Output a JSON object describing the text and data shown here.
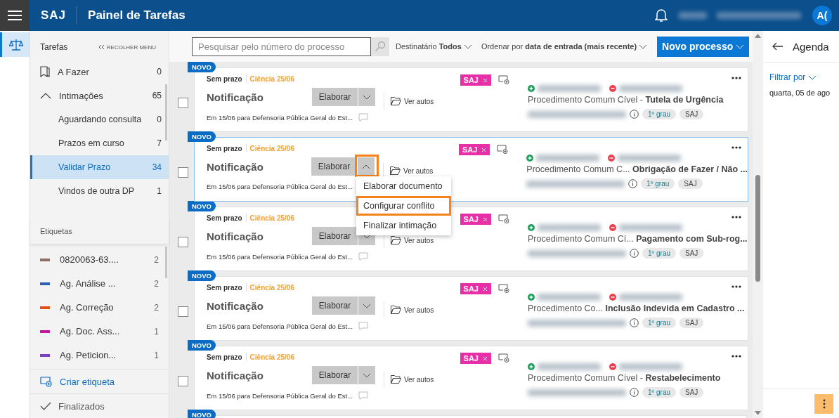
{
  "header": {
    "brand": "SAJ",
    "title": "Painel de Tarefas",
    "avatar": "A("
  },
  "sidebar": {
    "title": "Tarefas",
    "collapse": "RECOLHER MENU",
    "items": [
      {
        "kind": "bookmark",
        "label": "A Fazer",
        "count": "0",
        "selected": false
      },
      {
        "kind": "group",
        "label": "Intimações",
        "count": "65",
        "selected": false,
        "expanded": true,
        "children": [
          {
            "label": "Aguardando consulta",
            "count": "0",
            "selected": false
          },
          {
            "label": "Prazos em curso",
            "count": "7",
            "selected": false
          },
          {
            "label": "Validar Prazo",
            "count": "34",
            "selected": true
          },
          {
            "label": "Vindos de outra DP",
            "count": "1",
            "selected": false
          }
        ]
      }
    ],
    "labels_title": "Etiquetas",
    "labels": [
      {
        "label": "0820063-63....",
        "count": "2",
        "color": "#8d6e63"
      },
      {
        "label": "Ag. Análise ...",
        "count": "2",
        "color": "#2b5fb4"
      },
      {
        "label": "Ag. Correção",
        "count": "2",
        "color": "#e8500e"
      },
      {
        "label": "Ag. Doc. Ass...",
        "count": "1",
        "color": "#c0189f"
      },
      {
        "label": "Ag. Peticion...",
        "count": "1",
        "color": "#7b3fc4"
      }
    ],
    "create_label": "Criar etiqueta",
    "finished": "Finalizados"
  },
  "toolbar": {
    "search": {
      "placeholder": "Pesquisar pelo número do processo"
    },
    "recipient": {
      "label": "Destinatário",
      "value": "Todos"
    },
    "sort": {
      "label": "Ordenar por",
      "value": "data de entrada (mais recente)"
    },
    "new_button": "Novo processo"
  },
  "cards": [
    {
      "badge": "NOVO",
      "deadline": "Sem prazo",
      "notice": "Ciência 25/06",
      "title": "Notificação",
      "action": "Elaborar",
      "action_highlighted": false,
      "link": "Ver autos",
      "tag": "SAJ",
      "class": "Procedimento Comum Cível -",
      "subject": "Tutela de Urgência",
      "pills": [
        "1º grau",
        "SAJ"
      ],
      "note": "Em 15/06 para Defensoria Pública Geral do Est...",
      "checked": false,
      "selected": false
    },
    {
      "badge": "NOVO",
      "deadline": "Sem prazo",
      "notice": "Ciência 25/06",
      "title": "Notificação",
      "action": "Elaborar",
      "action_highlighted": true,
      "link": "Ver autos",
      "tag": "SAJ",
      "class": "Procedimento Comum C...",
      "subject": "Obrigação de Fazer / Não ...",
      "pills": [
        "1º grau",
        "SAJ"
      ],
      "note": "Em 15/06 para Defensoria Pública Geral do Est...",
      "checked": false,
      "selected": true,
      "menu": [
        {
          "label": "Elaborar documento",
          "highlighted": false
        },
        {
          "label": "Configurar conflito",
          "highlighted": true
        },
        {
          "label": "Finalizar intimação",
          "highlighted": false
        }
      ]
    },
    {
      "badge": "NOVO",
      "deadline": "Sem prazo",
      "notice": "Ciência 25/06",
      "title": "Notificação",
      "action": "Elaborar",
      "action_highlighted": false,
      "link": "Ver autos",
      "tag": "SAJ",
      "class": "Procedimento Comum Cí...",
      "subject": "Pagamento com Sub-rog...",
      "pills": [
        "1º grau",
        "SAJ"
      ],
      "note": "Em 15/06 para Defensoria Pública Geral do Est...",
      "checked": false,
      "selected": false
    },
    {
      "badge": "NOVO",
      "deadline": "Sem prazo",
      "notice": "Ciência 25/06",
      "title": "Notificação",
      "action": "Elaborar",
      "action_highlighted": false,
      "link": "Ver autos",
      "tag": "SAJ",
      "class": "Procedimento Co...",
      "subject": "Inclusão Indevida em Cadastro ...",
      "pills": [
        "1º grau",
        "SAJ"
      ],
      "note": "Em 15/06 para Defensoria Pública Geral do Est...",
      "checked": false,
      "selected": false
    },
    {
      "badge": "NOVO",
      "deadline": "Sem prazo",
      "notice": "Ciência 25/06",
      "title": "Notificação",
      "action": "Elaborar",
      "action_highlighted": false,
      "link": "Ver autos",
      "tag": "SAJ",
      "class": "Procedimento Comum Cível -",
      "subject": "Restabelecimento",
      "pills": [
        "1º grau",
        "SAJ"
      ],
      "note": "Em 15/06 para Defensoria Pública Geral do Est...",
      "checked": false,
      "selected": false
    }
  ],
  "next_card": {
    "badge": "NOVO"
  },
  "agenda": {
    "title": "Agenda",
    "filter": "Filtrar por",
    "date": "quarta, 05 de ago"
  }
}
